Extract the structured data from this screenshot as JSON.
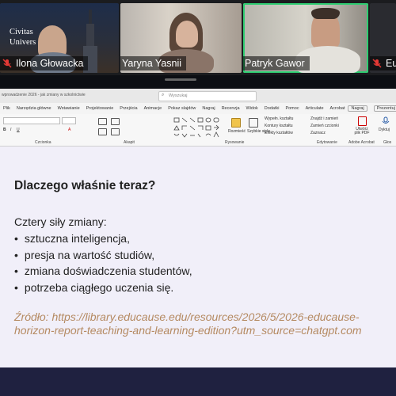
{
  "participants": [
    {
      "name": "Ilona Głowacka",
      "muted": true,
      "speaking": false,
      "logo_text": [
        "Civitas",
        "Univers"
      ]
    },
    {
      "name": "Yaryna Yasnii",
      "muted": false,
      "speaking": false
    },
    {
      "name": "Patryk Gawor",
      "muted": false,
      "speaking": true
    },
    {
      "name": "Eu",
      "muted": true,
      "speaking": false
    }
  ],
  "ribbon": {
    "doc_title": "wprowadzenie 2026 - jak zmiany w szkolnictwie",
    "search_placeholder": "Wyszukaj",
    "record_button": "Nagraj",
    "present_button": "Prezentuj",
    "tabs": [
      "Plik",
      "Narzędzia główne",
      "Wstawianie",
      "Projektowanie",
      "Przejścia",
      "Animacje",
      "Pokaz slajdów",
      "Nagraj",
      "Recenzja",
      "Widok",
      "Dodatki",
      "Pomoc",
      "Articulate",
      "Acrobat"
    ],
    "groups": [
      "Czcionka",
      "Akapit",
      "Rysowanie",
      "Edytowanie",
      "Adobe Acrobat",
      "Głos"
    ],
    "editing_items": [
      "Znajdź i zamień",
      "Zamień czcionki",
      "Zaznacz"
    ],
    "drawing_items": [
      "Wypełn. kształtu",
      "Kontury kształtu",
      "Efekty kształtów",
      "Rozmieść",
      "Szybkie style"
    ],
    "acrobat_button": "Utwórz plik PDF",
    "dictate_button": "Dyktuj"
  },
  "slide": {
    "title": "Dlaczego właśnie teraz?",
    "intro": "Cztery siły zmiany:",
    "bullets": [
      "sztuczna inteligencja,",
      "presja na wartość studiów,",
      "zmiana doświadczenia studentów,",
      "potrzeba ciągłego uczenia się."
    ],
    "source": "Źródło: https://library.educause.edu/resources/2026/5/2026-educause-horizon-report-teaching-and-learning-edition?utm_source=chatgpt.com"
  },
  "colors": {
    "speaker_border": "#2ecc71",
    "muted_icon": "#e53935",
    "source_text": "#b58a62",
    "slide_bg": "#f1eff9"
  }
}
